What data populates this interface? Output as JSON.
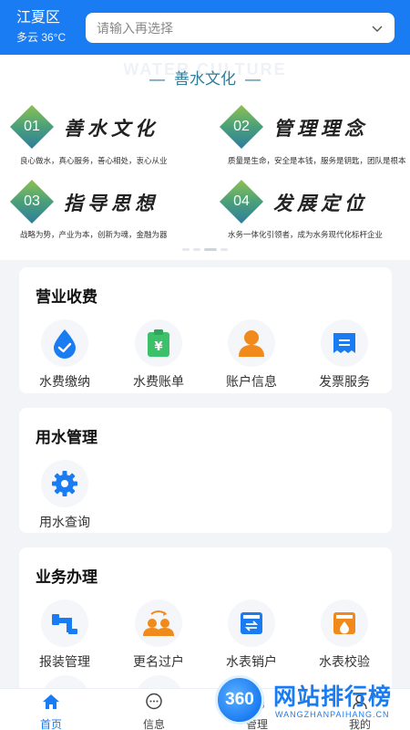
{
  "header": {
    "city": "江夏区",
    "weather": "多云 36°C",
    "search_placeholder": "请输入再选择"
  },
  "culture": {
    "watermark": "WATER CULTURE",
    "title": "善水文化",
    "pillars": [
      {
        "num": "01",
        "title": "善水文化",
        "desc": "良心做水，真心服务，善心相处，衷心从业"
      },
      {
        "num": "02",
        "title": "管理理念",
        "desc": "质量是生命，安全是本钱，服务是钥匙，团队是根本"
      },
      {
        "num": "03",
        "title": "指导思想",
        "desc": "战略为势，产业为本，创新为魂，金融为器"
      },
      {
        "num": "04",
        "title": "发展定位",
        "desc": "水务一体化引领者，成为水务现代化标杆企业"
      }
    ]
  },
  "sections": {
    "billing": {
      "title": "营业收费",
      "items": [
        {
          "label": "水费缴纳",
          "icon": "water-drop-check-icon"
        },
        {
          "label": "水费账单",
          "icon": "bill-clipboard-icon"
        },
        {
          "label": "账户信息",
          "icon": "user-account-icon"
        },
        {
          "label": "发票服务",
          "icon": "invoice-icon"
        }
      ]
    },
    "usage": {
      "title": "用水管理",
      "items": [
        {
          "label": "用水查询",
          "icon": "gear-icon"
        }
      ]
    },
    "business": {
      "title": "业务办理",
      "items": [
        {
          "label": "报装管理",
          "icon": "pipe-icon"
        },
        {
          "label": "更名过户",
          "icon": "transfer-users-icon"
        },
        {
          "label": "水表销户",
          "icon": "meter-cancel-icon"
        },
        {
          "label": "水表校验",
          "icon": "meter-check-icon"
        }
      ]
    }
  },
  "nav": {
    "items": [
      {
        "label": "首页",
        "icon": "home-icon",
        "active": true
      },
      {
        "label": "信息",
        "icon": "message-icon",
        "active": false
      },
      {
        "label": "管理",
        "icon": "manage-icon",
        "active": false
      },
      {
        "label": "我的",
        "icon": "profile-icon",
        "active": false
      }
    ]
  },
  "watermark360": {
    "logo": "360",
    "brand": "网站排行榜",
    "domain": "WANGZHANPAIHANG.CN"
  },
  "colors": {
    "primary": "#1a7cf2",
    "culture_teal": "#2e7d9c",
    "badge_green": "#6aae5f",
    "orange": "#f08a1c",
    "green": "#3cc06a"
  }
}
